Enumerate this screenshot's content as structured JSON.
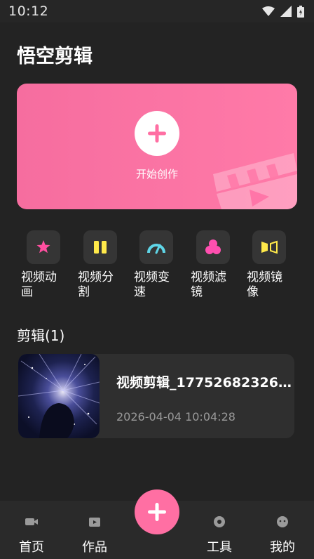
{
  "status_bar": {
    "time": "10:12"
  },
  "app": {
    "title": "悟空剪辑"
  },
  "hero": {
    "create_label": "开始创作"
  },
  "tools": [
    {
      "label": "视频动画",
      "icon": "star-animation-icon",
      "color": "#ff4fa0"
    },
    {
      "label": "视频分割",
      "icon": "split-icon",
      "color": "#ffe94a"
    },
    {
      "label": "视频变速",
      "icon": "speedometer-icon",
      "color": "#5fd6e8"
    },
    {
      "label": "视频滤镜",
      "icon": "filter-icon",
      "color": "#ff4fb0"
    },
    {
      "label": "视频镜像",
      "icon": "mirror-icon",
      "color": "#ffe94a"
    }
  ],
  "section": {
    "title": "剪辑",
    "count": "(1)"
  },
  "project": {
    "name": "视频剪辑_17752682326...",
    "date": "2026-04-04 10:04:28"
  },
  "nav": {
    "home": "首页",
    "works": "作品",
    "tools": "工具",
    "mine": "我的"
  },
  "colors": {
    "accent": "#ff6fa3",
    "background": "#232323",
    "card": "#2f2f2f"
  }
}
